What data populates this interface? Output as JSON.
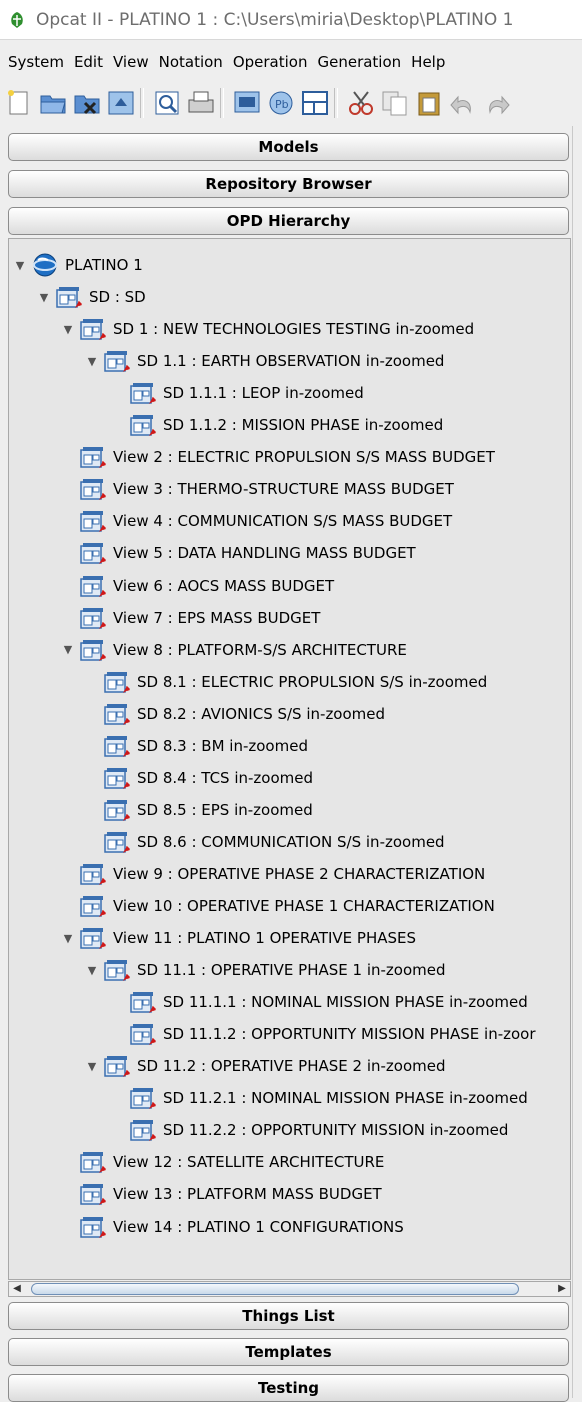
{
  "window": {
    "title": "Opcat II - PLATINO 1 : C:\\Users\\miria\\Desktop\\PLATINO 1"
  },
  "menu": [
    "System",
    "Edit",
    "View",
    "Notation",
    "Operation",
    "Generation",
    "Help"
  ],
  "toolbar": {
    "icons": [
      "new-icon",
      "open-icon",
      "close-icon",
      "save-icon",
      "preview-icon",
      "print-icon",
      "opd-icon",
      "zoom-icon",
      "layout-icon",
      "cut-icon",
      "copy-icon",
      "paste-icon",
      "undo-icon",
      "redo-icon"
    ]
  },
  "panels": {
    "models": "Models",
    "repository": "Repository Browser",
    "opd_hierarchy": "OPD Hierarchy",
    "things_list": "Things List",
    "templates": "Templates",
    "testing": "Testing"
  },
  "tree": {
    "root": "PLATINO 1",
    "nodes": [
      {
        "label": "SD : SD",
        "depth": 1,
        "expanded": true
      },
      {
        "label": "SD 1 : NEW TECHNOLOGIES TESTING in-zoomed",
        "depth": 2,
        "expanded": true
      },
      {
        "label": "SD 1.1 : EARTH OBSERVATION in-zoomed",
        "depth": 3,
        "expanded": true
      },
      {
        "label": "SD 1.1.1 : LEOP in-zoomed",
        "depth": 4
      },
      {
        "label": "SD 1.1.2 : MISSION PHASE in-zoomed",
        "depth": 4
      },
      {
        "label": "View 2 : ELECTRIC PROPULSION S/S MASS BUDGET",
        "depth": 2
      },
      {
        "label": "View 3 : THERMO-STRUCTURE MASS BUDGET",
        "depth": 2
      },
      {
        "label": "View 4 : COMMUNICATION S/S MASS BUDGET",
        "depth": 2
      },
      {
        "label": "View 5 : DATA HANDLING MASS BUDGET",
        "depth": 2
      },
      {
        "label": "View 6 : AOCS MASS BUDGET",
        "depth": 2
      },
      {
        "label": "View 7 : EPS MASS BUDGET",
        "depth": 2
      },
      {
        "label": "View 8 : PLATFORM-S/S  ARCHITECTURE",
        "depth": 2,
        "expanded": true
      },
      {
        "label": "SD 8.1 : ELECTRIC PROPULSION S/S in-zoomed",
        "depth": 3
      },
      {
        "label": "SD 8.2 : AVIONICS S/S in-zoomed",
        "depth": 3
      },
      {
        "label": "SD 8.3 : BM in-zoomed",
        "depth": 3
      },
      {
        "label": "SD 8.4 : TCS in-zoomed",
        "depth": 3
      },
      {
        "label": "SD 8.5 : EPS in-zoomed",
        "depth": 3
      },
      {
        "label": "SD 8.6 : COMMUNICATION S/S in-zoomed",
        "depth": 3
      },
      {
        "label": "View 9 : OPERATIVE PHASE 2 CHARACTERIZATION",
        "depth": 2
      },
      {
        "label": "View 10 : OPERATIVE PHASE 1 CHARACTERIZATION",
        "depth": 2
      },
      {
        "label": "View 11 : PLATINO 1 OPERATIVE PHASES",
        "depth": 2,
        "expanded": true
      },
      {
        "label": "SD 11.1 : OPERATIVE PHASE 1 in-zoomed",
        "depth": 3,
        "expanded": true
      },
      {
        "label": "SD 11.1.1 : NOMINAL MISSION PHASE in-zoomed",
        "depth": 4
      },
      {
        "label": "SD 11.1.2 : OPPORTUNITY MISSION PHASE in-zoor",
        "depth": 4
      },
      {
        "label": "SD 11.2 : OPERATIVE PHASE 2 in-zoomed",
        "depth": 3,
        "expanded": true
      },
      {
        "label": "SD 11.2.1 : NOMINAL MISSION PHASE in-zoomed",
        "depth": 4
      },
      {
        "label": "SD 11.2.2 : OPPORTUNITY MISSION in-zoomed",
        "depth": 4
      },
      {
        "label": "View 12 : SATELLITE ARCHITECTURE",
        "depth": 2
      },
      {
        "label": "View 13 : PLATFORM MASS BUDGET",
        "depth": 2
      },
      {
        "label": "View 14 : PLATINO 1 CONFIGURATIONS",
        "depth": 2
      }
    ]
  },
  "colors": {
    "opd_icon_blue": "#3a6fb0",
    "opd_icon_red": "#d01818",
    "title_icon_green": "#2f8f2f"
  }
}
